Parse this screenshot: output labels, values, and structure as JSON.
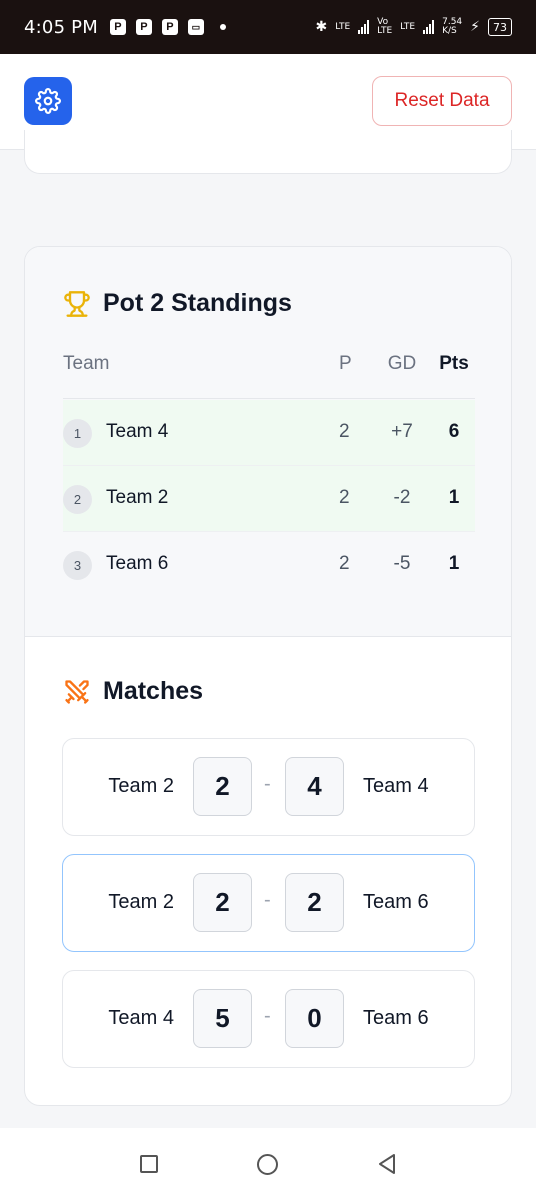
{
  "status_bar": {
    "time": "4:05 PM",
    "net1": "LTE",
    "net2_top": "Vo",
    "net2_bottom": "LTE",
    "net3": "LTE",
    "speed_top": "7.54",
    "speed_bottom": "K/S",
    "battery": "73"
  },
  "header": {
    "reset_label": "Reset Data"
  },
  "standings": {
    "title": "Pot 2 Standings",
    "columns": {
      "team": "Team",
      "p": "P",
      "gd": "GD",
      "pts": "Pts"
    },
    "rows": [
      {
        "rank": "1",
        "team": "Team 4",
        "p": "2",
        "gd": "+7",
        "pts": "6"
      },
      {
        "rank": "2",
        "team": "Team 2",
        "p": "2",
        "gd": "-2",
        "pts": "1"
      },
      {
        "rank": "3",
        "team": "Team 6",
        "p": "2",
        "gd": "-5",
        "pts": "1"
      }
    ]
  },
  "matches": {
    "title": "Matches",
    "list": [
      {
        "home": "Team 2",
        "home_score": "2",
        "sep": "-",
        "away_score": "4",
        "away": "Team 4"
      },
      {
        "home": "Team 2",
        "home_score": "2",
        "sep": "-",
        "away_score": "2",
        "away": "Team 6"
      },
      {
        "home": "Team 4",
        "home_score": "5",
        "sep": "-",
        "away_score": "0",
        "away": "Team 6"
      }
    ]
  },
  "colors": {
    "accent": "#2563eb",
    "danger": "#dc2626",
    "trophy": "#eab308",
    "swords": "#f97316",
    "highlight_row": "#f0faf2"
  }
}
